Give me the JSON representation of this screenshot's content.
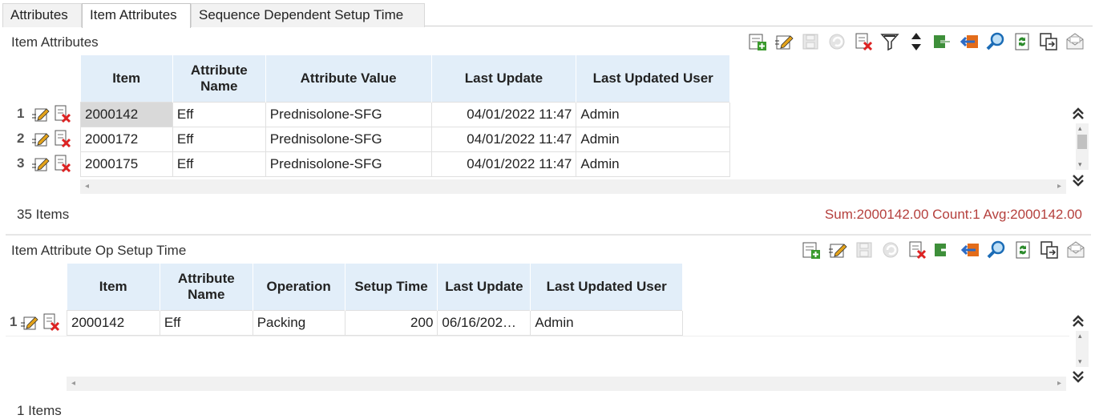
{
  "tabs": [
    {
      "label": "Attributes",
      "active": false
    },
    {
      "label": "Item Attributes",
      "active": true
    },
    {
      "label": "Sequence Dependent Setup Time",
      "active": false
    }
  ],
  "item_attributes": {
    "title": "Item Attributes",
    "columns": [
      "Item",
      "Attribute Name",
      "Attribute Value",
      "Last Update",
      "Last Updated User"
    ],
    "rows": [
      {
        "num": "1",
        "item": "2000142",
        "attr": "Eff",
        "value": "Prednisolone-SFG",
        "updated": "04/01/2022 11:47",
        "user": "Admin"
      },
      {
        "num": "2",
        "item": "2000172",
        "attr": "Eff",
        "value": "Prednisolone-SFG",
        "updated": "04/01/2022 11:47",
        "user": "Admin"
      },
      {
        "num": "3",
        "item": "2000175",
        "attr": "Eff",
        "value": "Prednisolone-SFG",
        "updated": "04/01/2022 11:47",
        "user": "Admin"
      }
    ],
    "count_label": "35 Items",
    "stats": "Sum:2000142.00 Count:1 Avg:2000142.00"
  },
  "op_setup": {
    "title": "Item Attribute Op Setup Time",
    "columns": [
      "Item",
      "Attribute Name",
      "Operation",
      "Setup Time",
      "Last Update",
      "Last Updated User"
    ],
    "rows": [
      {
        "num": "1",
        "item": "2000142",
        "attr": "Eff",
        "operation": "Packing",
        "setup": "200",
        "updated": "06/16/202…",
        "user": "Admin"
      }
    ],
    "count_label": "1 Items"
  },
  "colors": {
    "header_bg": "#e2eef9",
    "stats": "#b5403d",
    "selected_cell": "#d9d9d9"
  }
}
